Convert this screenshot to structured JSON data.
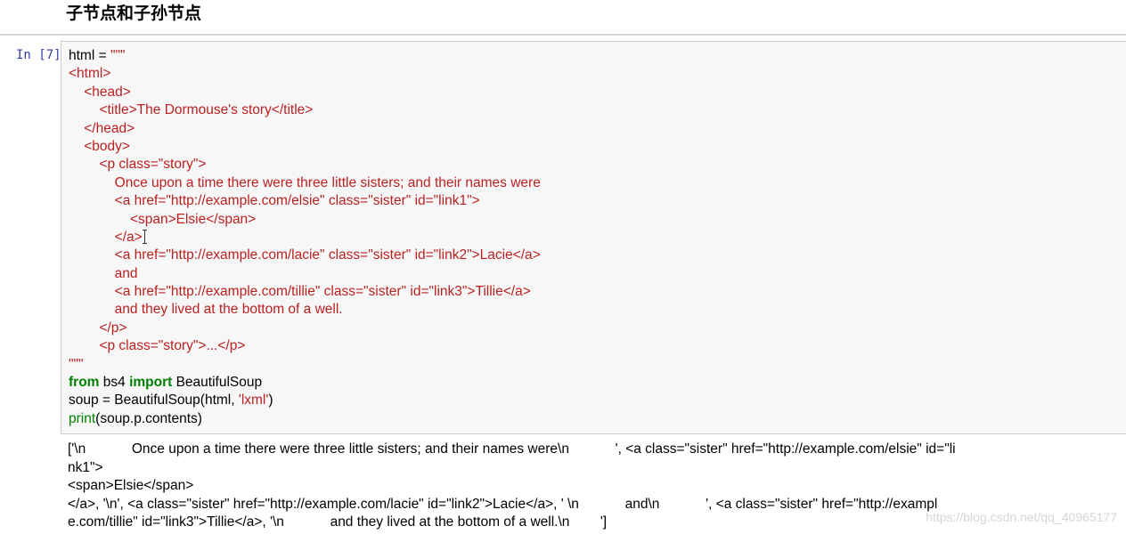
{
  "heading": "子节点和子孙节点",
  "cell": {
    "prompt": "In [7]:",
    "code_lines": [
      [
        {
          "t": "html = ",
          "c": "txt"
        },
        {
          "t": "\"\"\"",
          "c": "str"
        }
      ],
      [
        {
          "t": "<html>",
          "c": "str"
        }
      ],
      [
        {
          "t": "    <head>",
          "c": "str"
        }
      ],
      [
        {
          "t": "        <title>The Dormouse's story</title>",
          "c": "str"
        }
      ],
      [
        {
          "t": "    </head>",
          "c": "str"
        }
      ],
      [
        {
          "t": "    <body>",
          "c": "str"
        }
      ],
      [
        {
          "t": "        <p class=\"story\">",
          "c": "str"
        }
      ],
      [
        {
          "t": "            Once upon a time there were three little sisters; and their names were",
          "c": "str"
        }
      ],
      [
        {
          "t": "            <a href=\"http://example.com/elsie\" class=\"sister\" id=\"link1\">",
          "c": "str"
        }
      ],
      [
        {
          "t": "                <span>Elsie</span>",
          "c": "str"
        }
      ],
      [
        {
          "t": "            </a>",
          "c": "str"
        }
      ],
      [
        {
          "t": "            <a href=\"http://example.com/lacie\" class=\"sister\" id=\"link2\">Lacie</a>",
          "c": "str"
        }
      ],
      [
        {
          "t": "            and",
          "c": "str"
        }
      ],
      [
        {
          "t": "            <a href=\"http://example.com/tillie\" class=\"sister\" id=\"link3\">Tillie</a>",
          "c": "str"
        }
      ],
      [
        {
          "t": "            and they lived at the bottom of a well.",
          "c": "str"
        }
      ],
      [
        {
          "t": "        </p>",
          "c": "str"
        }
      ],
      [
        {
          "t": "        <p class=\"story\">...</p>",
          "c": "str"
        }
      ],
      [
        {
          "t": "\"\"\"",
          "c": "str"
        }
      ],
      [
        {
          "t": "from",
          "c": "kw"
        },
        {
          "t": " bs4 ",
          "c": "txt"
        },
        {
          "t": "import",
          "c": "kw"
        },
        {
          "t": " BeautifulSoup",
          "c": "txt"
        }
      ],
      [
        {
          "t": "soup = BeautifulSoup(html, ",
          "c": "txt"
        },
        {
          "t": "'lxml'",
          "c": "str"
        },
        {
          "t": ")",
          "c": "txt"
        }
      ],
      [
        {
          "t": "print",
          "c": "bi"
        },
        {
          "t": "(soup.p.contents)",
          "c": "txt"
        }
      ]
    ],
    "output_lines": [
      "['\\n            Once upon a time there were three little sisters; and their names were\\n            ', <a class=\"sister\" href=\"http://example.com/elsie\" id=\"li",
      "nk1\">",
      "<span>Elsie</span>",
      "</a>, '\\n', <a class=\"sister\" href=\"http://example.com/lacie\" id=\"link2\">Lacie</a>, ' \\n            and\\n            ', <a class=\"sister\" href=\"http://exampl",
      "e.com/tillie\" id=\"link3\">Tillie</a>, '\\n            and they lived at the bottom of a well.\\n        ']"
    ]
  },
  "watermark": "https://blog.csdn.net/qq_40965177"
}
